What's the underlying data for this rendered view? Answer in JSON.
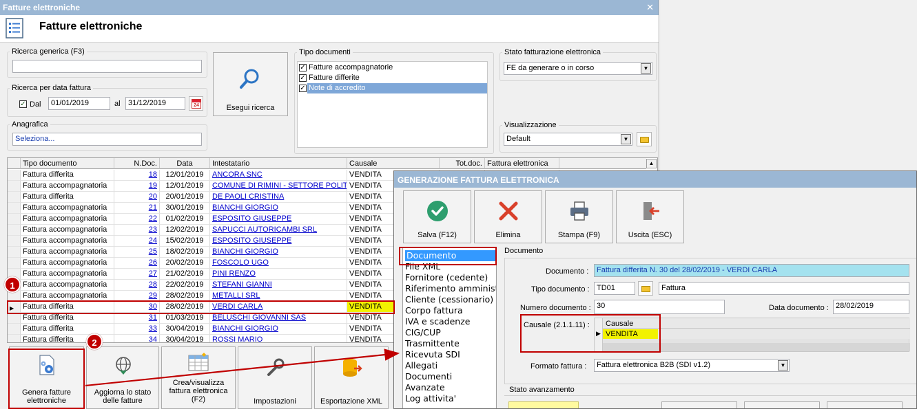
{
  "main_window": {
    "title": "Fatture elettroniche",
    "close_glyph": "✕",
    "header_title": "Fatture elettroniche"
  },
  "search": {
    "generic_label": "Ricerca generica (F3)",
    "generic_value": "",
    "date_group_label": "Ricerca per data fattura",
    "dal_checked": true,
    "dal_label": "Dal",
    "dal_value": "01/01/2019",
    "al_label": "al",
    "al_value": "31/12/2019",
    "calendar_icon_text": "24",
    "anagrafica_label": "Anagrafica",
    "anagrafica_value": "Seleziona...",
    "search_button_label": "Esegui ricerca"
  },
  "tipo_documenti": {
    "label": "Tipo documenti",
    "items": [
      {
        "label": "Fatture accompagnatorie",
        "checked": true,
        "selected": false
      },
      {
        "label": "Fatture differite",
        "checked": true,
        "selected": false
      },
      {
        "label": "Note di accredito",
        "checked": true,
        "selected": true
      }
    ]
  },
  "stato_fe": {
    "label": "Stato fatturazione elettronica",
    "value": "FE da generare o in corso"
  },
  "visualizzazione": {
    "label": "Visualizzazione",
    "value": "Default"
  },
  "grid": {
    "columns": [
      "Tipo documento",
      "N.Doc.",
      "Data",
      "Intestatario",
      "Causale",
      "Tot.doc.",
      "Fattura elettronica"
    ],
    "rows": [
      {
        "tipo": "Fattura differita",
        "ndoc": "18",
        "data": "12/01/2019",
        "intestatario": "ANCORA SNC",
        "causale": "VENDITA",
        "selected": false
      },
      {
        "tipo": "Fattura accompagnatoria",
        "ndoc": "19",
        "data": "12/01/2019",
        "intestatario": "COMUNE DI RIMINI - SETTORE POLIT...",
        "causale": "VENDITA",
        "selected": false
      },
      {
        "tipo": "Fattura differita",
        "ndoc": "20",
        "data": "20/01/2019",
        "intestatario": "DE PAOLI CRISTINA",
        "causale": "VENDITA",
        "selected": false
      },
      {
        "tipo": "Fattura accompagnatoria",
        "ndoc": "21",
        "data": "30/01/2019",
        "intestatario": "BIANCHI GIORGIO",
        "causale": "VENDITA",
        "selected": false
      },
      {
        "tipo": "Fattura accompagnatoria",
        "ndoc": "22",
        "data": "01/02/2019",
        "intestatario": "ESPOSITO GIUSEPPE",
        "causale": "VENDITA",
        "selected": false
      },
      {
        "tipo": "Fattura accompagnatoria",
        "ndoc": "23",
        "data": "12/02/2019",
        "intestatario": "SAPUCCI AUTORICAMBI SRL",
        "causale": "VENDITA",
        "selected": false
      },
      {
        "tipo": "Fattura accompagnatoria",
        "ndoc": "24",
        "data": "15/02/2019",
        "intestatario": "ESPOSITO GIUSEPPE",
        "causale": "VENDITA",
        "selected": false
      },
      {
        "tipo": "Fattura accompagnatoria",
        "ndoc": "25",
        "data": "18/02/2019",
        "intestatario": "BIANCHI GIORGIO",
        "causale": "VENDITA",
        "selected": false
      },
      {
        "tipo": "Fattura accompagnatoria",
        "ndoc": "26",
        "data": "20/02/2019",
        "intestatario": "FOSCOLO UGO",
        "causale": "VENDITA",
        "selected": false
      },
      {
        "tipo": "Fattura accompagnatoria",
        "ndoc": "27",
        "data": "21/02/2019",
        "intestatario": "PINI RENZO",
        "causale": "VENDITA",
        "selected": false
      },
      {
        "tipo": "Fattura accompagnatoria",
        "ndoc": "28",
        "data": "22/02/2019",
        "intestatario": "STEFANI GIANNI",
        "causale": "VENDITA",
        "selected": false
      },
      {
        "tipo": "Fattura accompagnatoria",
        "ndoc": "29",
        "data": "28/02/2019",
        "intestatario": "METALLI SRL",
        "causale": "VENDITA",
        "selected": false
      },
      {
        "tipo": "Fattura differita",
        "ndoc": "30",
        "data": "28/02/2019",
        "intestatario": "VERDI CARLA",
        "causale": "VENDITA",
        "selected": true
      },
      {
        "tipo": "Fattura differita",
        "ndoc": "31",
        "data": "01/03/2019",
        "intestatario": "BELUSCHI GIOVANNI SAS",
        "causale": "VENDITA",
        "selected": false
      },
      {
        "tipo": "Fattura differita",
        "ndoc": "33",
        "data": "30/04/2019",
        "intestatario": "BIANCHI GIORGIO",
        "causale": "VENDITA",
        "selected": false
      },
      {
        "tipo": "Fattura differita",
        "ndoc": "34",
        "data": "30/04/2019",
        "intestatario": "ROSSI MARIO",
        "causale": "VENDITA",
        "selected": false
      }
    ]
  },
  "toolbar": {
    "genera": "Genera fatture elettroniche",
    "aggiorna": "Aggiorna lo stato delle fatture",
    "crea": "Crea/visualizza fattura elettronica (F2)",
    "impostazioni": "Impostazioni",
    "esportazione": "Esportazione XML"
  },
  "annotations": {
    "badge1": "1",
    "badge2": "2"
  },
  "dialog": {
    "title": "GENERAZIONE FATTURA ELETTRONICA",
    "buttons": {
      "salva": "Salva (F12)",
      "elimina": "Elimina",
      "stampa": "Stampa (F9)",
      "uscita": "Uscita (ESC)"
    },
    "nav": [
      {
        "label": "Documento",
        "selected": true
      },
      {
        "label": "File XML",
        "selected": false
      },
      {
        "label": "Fornitore (cedente)",
        "selected": false
      },
      {
        "label": "Riferimento amministra",
        "selected": false
      },
      {
        "label": "Cliente (cessionario)",
        "selected": false
      },
      {
        "label": "Corpo fattura",
        "selected": false
      },
      {
        "label": "IVA e scadenze",
        "selected": false
      },
      {
        "label": "CIG/CUP",
        "selected": false
      },
      {
        "label": "Trasmittente",
        "selected": false
      },
      {
        "label": "Ricevuta SDI",
        "selected": false
      },
      {
        "label": "Allegati",
        "selected": false
      },
      {
        "label": "Documenti",
        "selected": false
      },
      {
        "label": "Avanzate",
        "selected": false
      },
      {
        "label": "Log attivita'",
        "selected": false
      }
    ],
    "section_label": "Documento",
    "documento_label": "Documento :",
    "documento_value": "Fattura differita N. 30 del 28/02/2019 - VERDI CARLA",
    "tipo_label": "Tipo documento :",
    "tipo_code": "TD01",
    "tipo_desc": "Fattura",
    "numero_label": "Numero documento :",
    "numero_value": "30",
    "data_label": "Data documento :",
    "data_value": "28/02/2019",
    "causale_label": "Causale (2.1.1.11) :",
    "causale_header": "Causale",
    "causale_value": "VENDITA",
    "formato_label": "Formato fattura :",
    "formato_value": "Fattura elettronica B2B (SDI v1.2)",
    "stato_label": "Stato avanzamento"
  }
}
